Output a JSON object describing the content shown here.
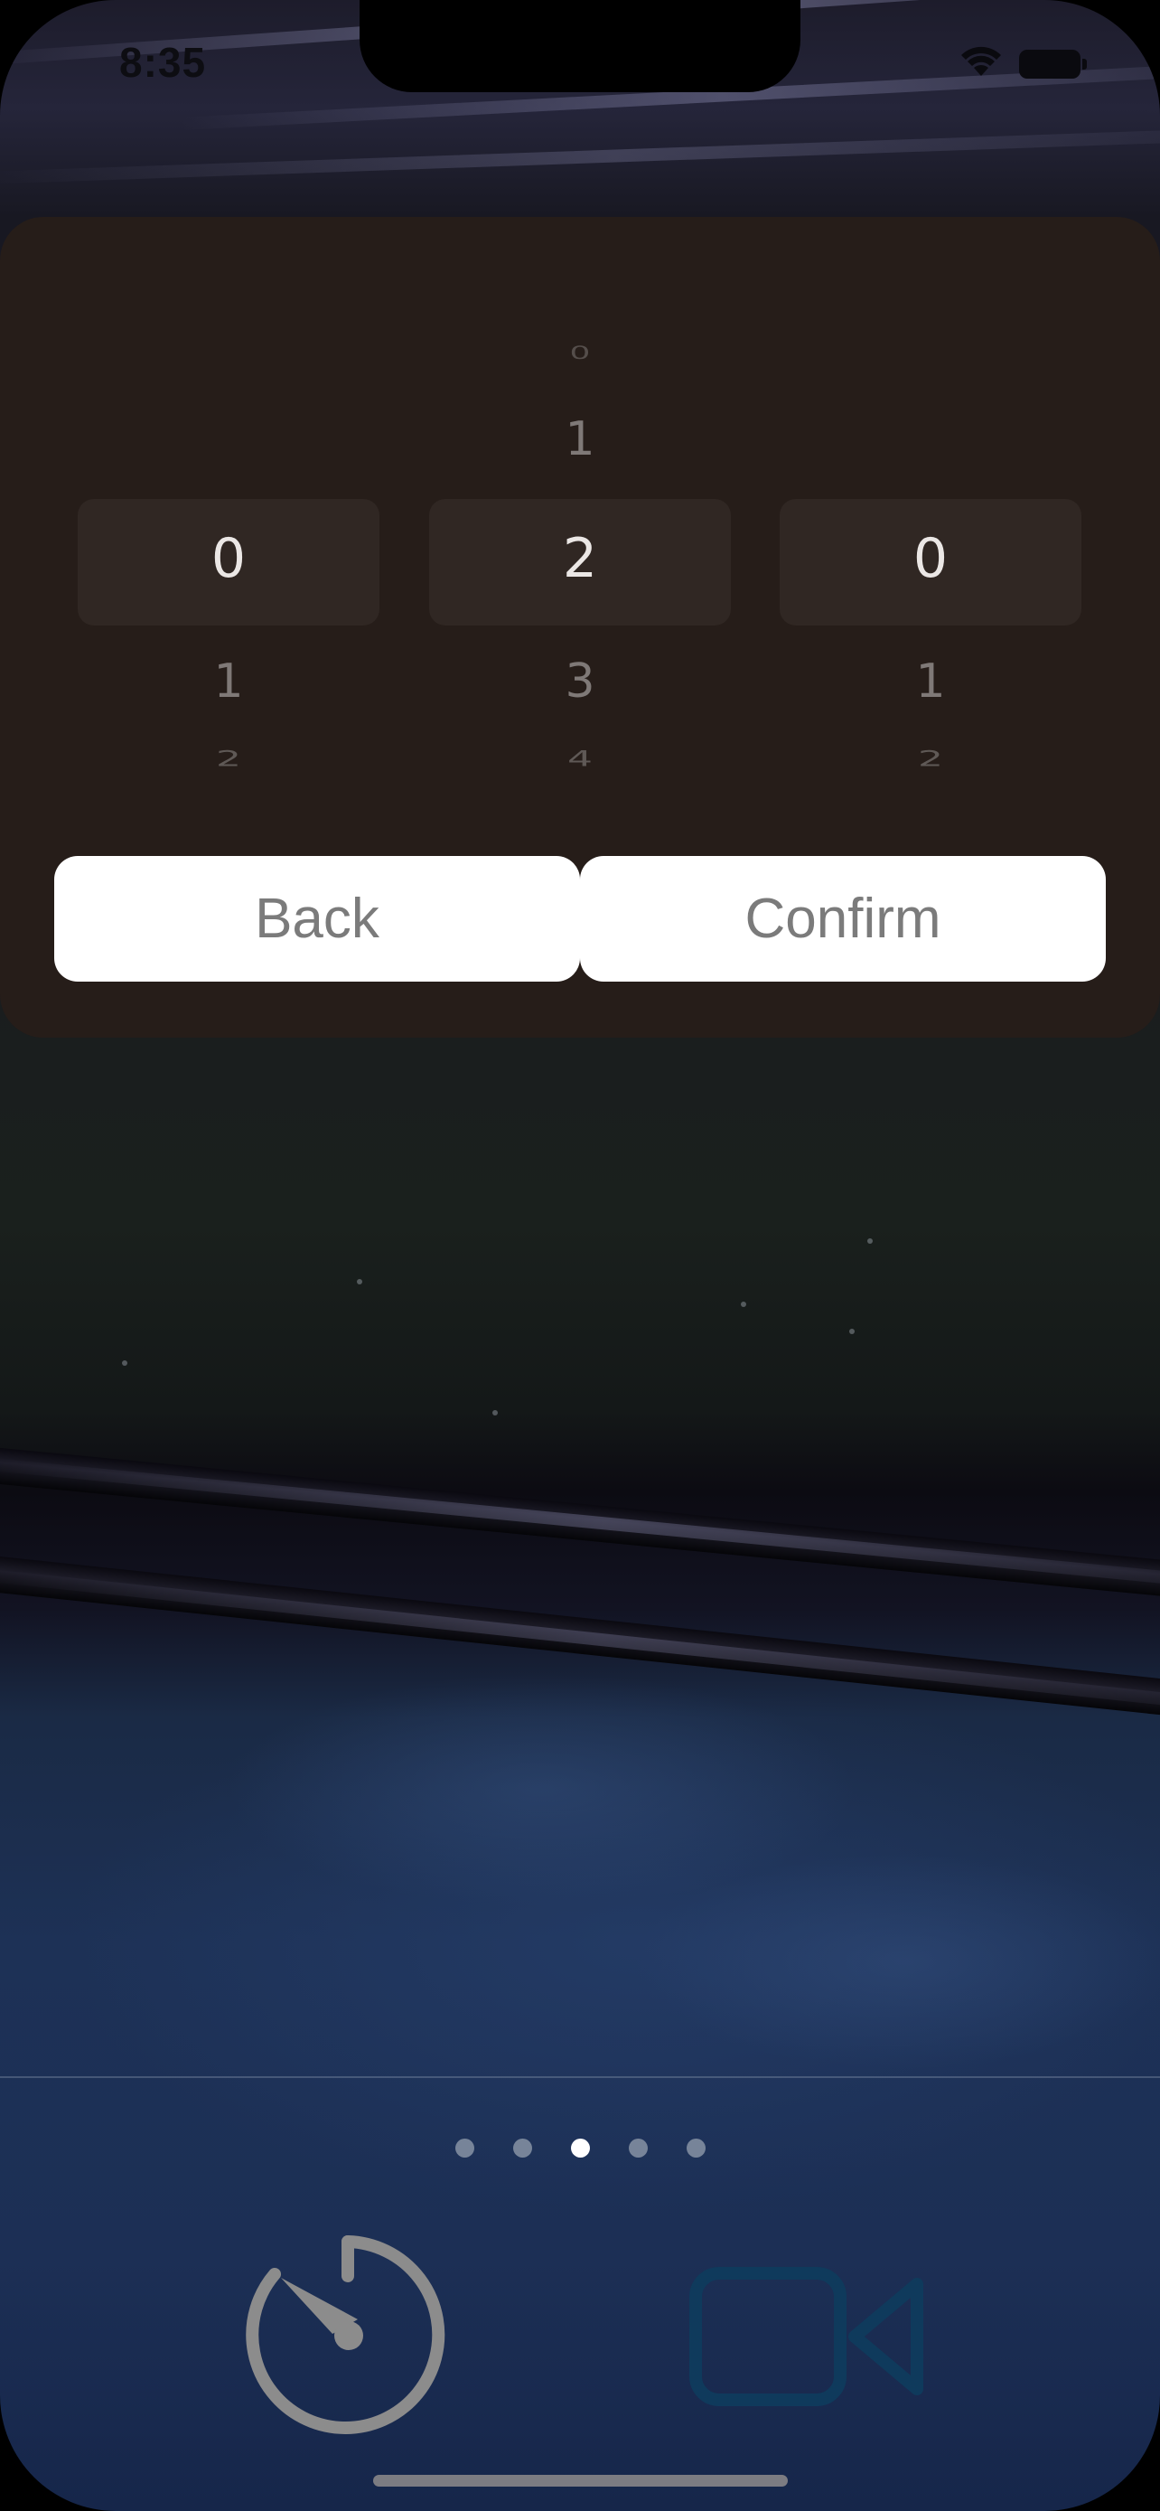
{
  "status_bar": {
    "time": "8:35",
    "icons": [
      "wifi-icon",
      "battery-icon"
    ]
  },
  "picker": {
    "columns": [
      {
        "name": "hours",
        "far_up": "",
        "up": "",
        "selected": "0",
        "down": "1",
        "far_down": "2"
      },
      {
        "name": "minutes",
        "far_up": "0",
        "up": "1",
        "selected": "2",
        "down": "3",
        "far_down": "4"
      },
      {
        "name": "seconds",
        "far_up": "",
        "up": "",
        "selected": "0",
        "down": "1",
        "far_down": "2"
      }
    ]
  },
  "buttons": {
    "back_label": "Back",
    "confirm_label": "Confirm"
  },
  "pager": {
    "count": 5,
    "active_index": 2
  },
  "toolbar": {
    "timer_icon": "timer-icon",
    "video_icon": "video-camera-icon",
    "timer_color": "#8c8c8c",
    "video_color": "#0f3a5c"
  },
  "colors": {
    "panel": "#261d19",
    "selection": "#302723",
    "button_bg": "#ffffff",
    "button_text": "#7b7b7b"
  }
}
